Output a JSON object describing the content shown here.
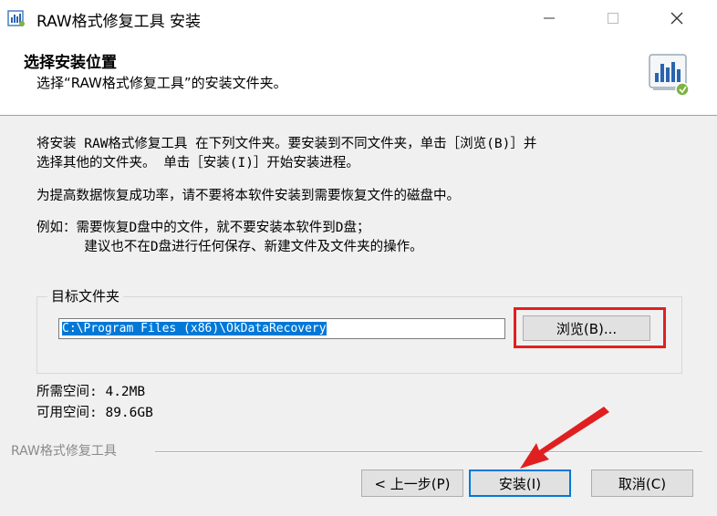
{
  "window": {
    "title": "RAW格式修复工具 安装",
    "controls": {
      "minimize": "—",
      "maximize": "☐",
      "close": "✕"
    }
  },
  "header": {
    "title": "选择安装位置",
    "subtitle": "选择“RAW格式修复工具”的安装文件夹。",
    "icon": "installer-disk-icon"
  },
  "body": {
    "line1": "将安装 RAW格式修复工具 在下列文件夹。要安装到不同文件夹，单击［浏览(B)］并",
    "line2": "选择其他的文件夹。 单击［安装(I)］开始安装进程。",
    "line3": "为提高数据恢复成功率，请不要将本软件安装到需要恢复文件的磁盘中。",
    "line4": "例如：需要恢复D盘中的文件，就不要安装本软件到D盘；",
    "line5": "      建议也不在D盘进行任何保存、新建文件及文件夹的操作。"
  },
  "destination": {
    "group_label": "目标文件夹",
    "path": "C:\\Program Files (x86)\\OkDataRecovery",
    "browse_label": "浏览(B)..."
  },
  "space": {
    "required": "所需空间: 4.2MB",
    "available": "可用空间: 89.6GB"
  },
  "branding": "RAW格式修复工具",
  "buttons": {
    "back": "< 上一步(P)",
    "install": "安装(I)",
    "cancel": "取消(C)"
  },
  "colors": {
    "accent": "#0078d7",
    "annotation": "#e02020"
  }
}
